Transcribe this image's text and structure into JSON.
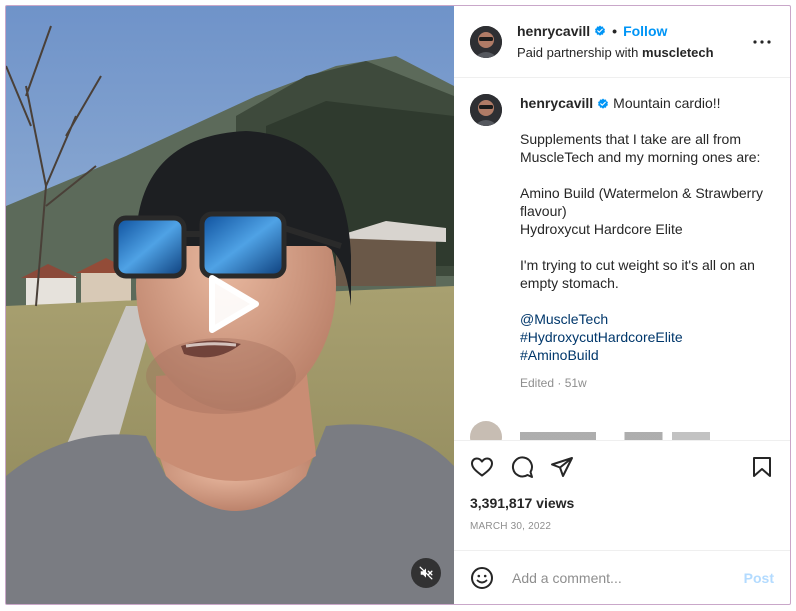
{
  "post": {
    "username": "henrycavill",
    "follow_label": "Follow",
    "dot": "•",
    "partnership_prefix": "Paid partnership with",
    "partner": "muscletech",
    "caption_lead": "Mountain cardio!!",
    "caption_p1": "Supplements that I take are all from MuscleTech and my morning ones are:",
    "caption_p2a": "Amino Build (Watermelon & Strawberry flavour)",
    "caption_p2b": "Hydroxycut Hardcore Elite",
    "caption_p3": "I'm trying to cut weight so it's all on an empty stomach.",
    "hashtags": [
      "@MuscleTech",
      "#HydroxycutHardcoreElite",
      "#AminoBuild"
    ],
    "meta": "Edited · 51w",
    "views": "3,391,817 views",
    "date": "MARCH 30, 2022"
  },
  "composer": {
    "placeholder": "Add a comment...",
    "post_label": "Post"
  },
  "icons": {
    "like": "heart-icon",
    "comment": "comment-icon",
    "share": "share-icon",
    "save": "bookmark-icon",
    "emoji": "emoji-icon",
    "more": "more-icon",
    "play": "play-icon",
    "mute": "muted-speaker-icon",
    "verified": "verified-badge-icon"
  },
  "colors": {
    "follow": "#0095f6",
    "hashtag": "#00376b",
    "post_disabled": "#b3dbff",
    "meta": "#8e8e8e"
  }
}
